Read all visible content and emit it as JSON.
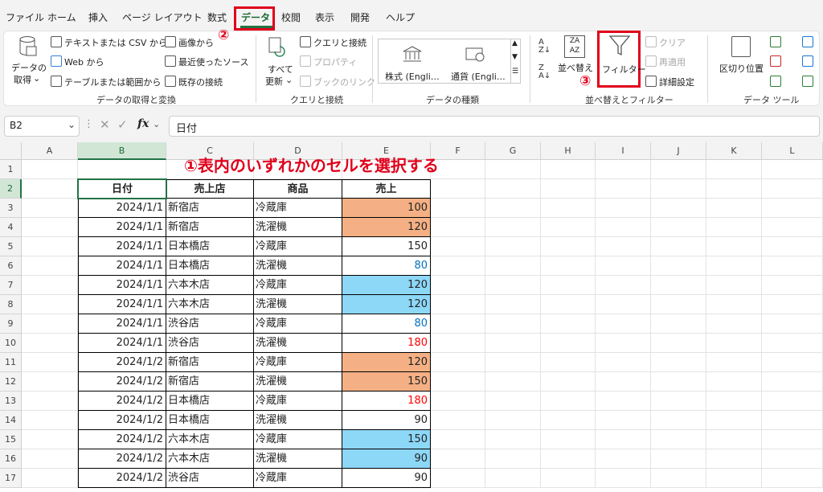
{
  "menu": {
    "items": [
      "ファイル",
      "ホーム",
      "挿入",
      "ページ レイアウト",
      "数式",
      "データ",
      "校閲",
      "表示",
      "開発",
      "ヘルプ"
    ],
    "active": "データ"
  },
  "ribbon": {
    "get": {
      "big_label_1": "データの",
      "big_label_2": "取得",
      "items": [
        "テキストまたは CSV から",
        "Web から",
        "テーブルまたは範囲から",
        "画像から",
        "最近使ったソース",
        "既存の接続"
      ],
      "group": "データの取得と変換"
    },
    "queries": {
      "refresh_1": "すべて",
      "refresh_2": "更新",
      "items": [
        "クエリと接続",
        "プロパティ",
        "ブックのリンク"
      ],
      "group": "クエリと接続"
    },
    "datatypes": {
      "stock": "株式 (Engli…",
      "currency": "通貨 (Engli…",
      "group": "データの種類"
    },
    "sort": {
      "sort_label": "並べ替え",
      "filter_label": "フィルター",
      "items": [
        "クリア",
        "再適用",
        "詳細設定"
      ],
      "group": "並べ替えとフィルター"
    },
    "tools": {
      "split": "区切り位置",
      "group": "データ ツール"
    }
  },
  "annotations": {
    "step1": "①表内のいずれかのセルを選択する",
    "step2": "②",
    "step3": "③"
  },
  "formula": {
    "namebox": "B2",
    "fx": "fx",
    "value": "日付"
  },
  "columns": [
    "A",
    "B",
    "C",
    "D",
    "E",
    "F",
    "G",
    "H",
    "I",
    "J",
    "K",
    "L"
  ],
  "rows": [
    "1",
    "2",
    "3",
    "4",
    "5",
    "6",
    "7",
    "8",
    "9",
    "10",
    "11",
    "12",
    "13",
    "14",
    "15",
    "16",
    "17"
  ],
  "colors": {
    "orange": "#f4b084",
    "blue": "#8dd7f7",
    "red_text": "#ff0000",
    "blue_text": "#0070c0",
    "accent": "#217346",
    "annotation_red": "#e0001b"
  },
  "table": {
    "headers": [
      "日付",
      "売上店",
      "商品",
      "売上"
    ],
    "rows": [
      {
        "date": "2024/1/1",
        "store": "新宿店",
        "product": "冷蔵庫",
        "sales": "100",
        "fill": "orange",
        "font": "normal"
      },
      {
        "date": "2024/1/1",
        "store": "新宿店",
        "product": "洗濯機",
        "sales": "120",
        "fill": "orange",
        "font": "normal"
      },
      {
        "date": "2024/1/1",
        "store": "日本橋店",
        "product": "冷蔵庫",
        "sales": "150",
        "fill": "none",
        "font": "normal"
      },
      {
        "date": "2024/1/1",
        "store": "日本橋店",
        "product": "洗濯機",
        "sales": "80",
        "fill": "none",
        "font": "blue"
      },
      {
        "date": "2024/1/1",
        "store": "六本木店",
        "product": "冷蔵庫",
        "sales": "120",
        "fill": "blue",
        "font": "normal"
      },
      {
        "date": "2024/1/1",
        "store": "六本木店",
        "product": "洗濯機",
        "sales": "120",
        "fill": "blue",
        "font": "normal"
      },
      {
        "date": "2024/1/1",
        "store": "渋谷店",
        "product": "冷蔵庫",
        "sales": "80",
        "fill": "none",
        "font": "blue"
      },
      {
        "date": "2024/1/1",
        "store": "渋谷店",
        "product": "洗濯機",
        "sales": "180",
        "fill": "none",
        "font": "red"
      },
      {
        "date": "2024/1/2",
        "store": "新宿店",
        "product": "冷蔵庫",
        "sales": "120",
        "fill": "orange",
        "font": "normal"
      },
      {
        "date": "2024/1/2",
        "store": "新宿店",
        "product": "洗濯機",
        "sales": "150",
        "fill": "orange",
        "font": "normal"
      },
      {
        "date": "2024/1/2",
        "store": "日本橋店",
        "product": "冷蔵庫",
        "sales": "180",
        "fill": "none",
        "font": "red"
      },
      {
        "date": "2024/1/2",
        "store": "日本橋店",
        "product": "洗濯機",
        "sales": "90",
        "fill": "none",
        "font": "normal"
      },
      {
        "date": "2024/1/2",
        "store": "六本木店",
        "product": "冷蔵庫",
        "sales": "150",
        "fill": "blue",
        "font": "normal"
      },
      {
        "date": "2024/1/2",
        "store": "六本木店",
        "product": "洗濯機",
        "sales": "90",
        "fill": "blue",
        "font": "normal"
      },
      {
        "date": "2024/1/2",
        "store": "渋谷店",
        "product": "冷蔵庫",
        "sales": "90",
        "fill": "none",
        "font": "normal"
      }
    ]
  }
}
